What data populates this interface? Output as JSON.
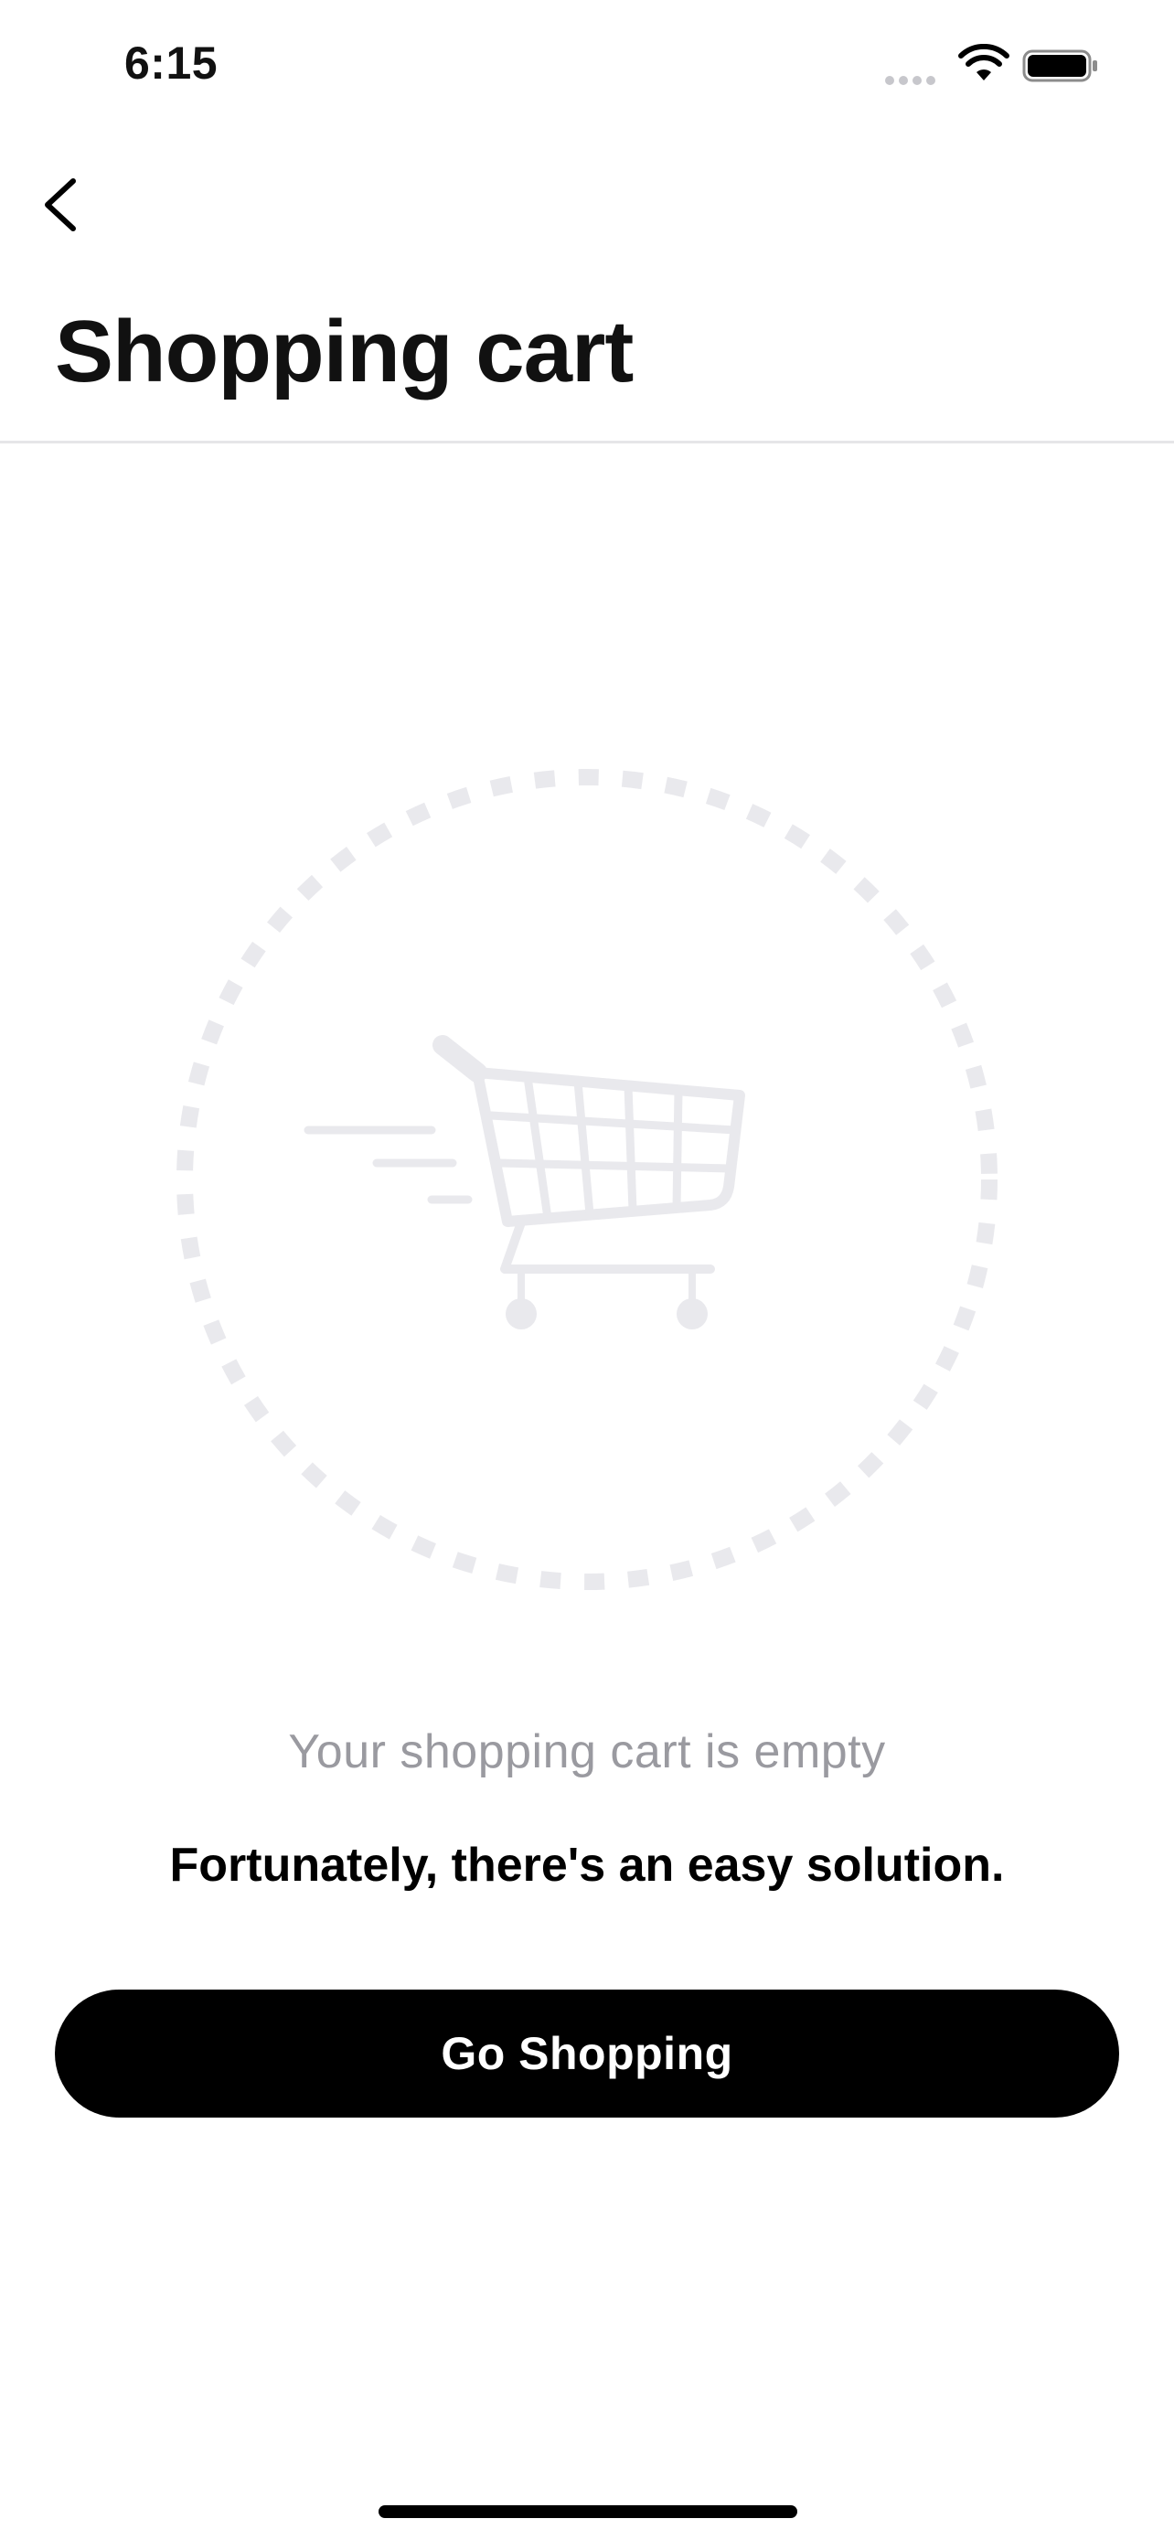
{
  "status_bar": {
    "time": "6:15",
    "icons": [
      "signal-dots-icon",
      "wifi-icon",
      "battery-icon"
    ]
  },
  "header": {
    "back_icon": "chevron-left-icon",
    "title": "Shopping cart"
  },
  "empty_state": {
    "illustration_icon": "shopping-cart-icon",
    "title": "Your shopping cart is empty",
    "subtitle": "Fortunately, there's an easy solution."
  },
  "actions": {
    "go_shopping_label": "Go Shopping"
  },
  "colors": {
    "button_background": "#000000",
    "button_text": "#ffffff",
    "illustration": "#e9e9ed",
    "muted_text": "#9a9aa0",
    "divider": "#e6e6e8"
  }
}
